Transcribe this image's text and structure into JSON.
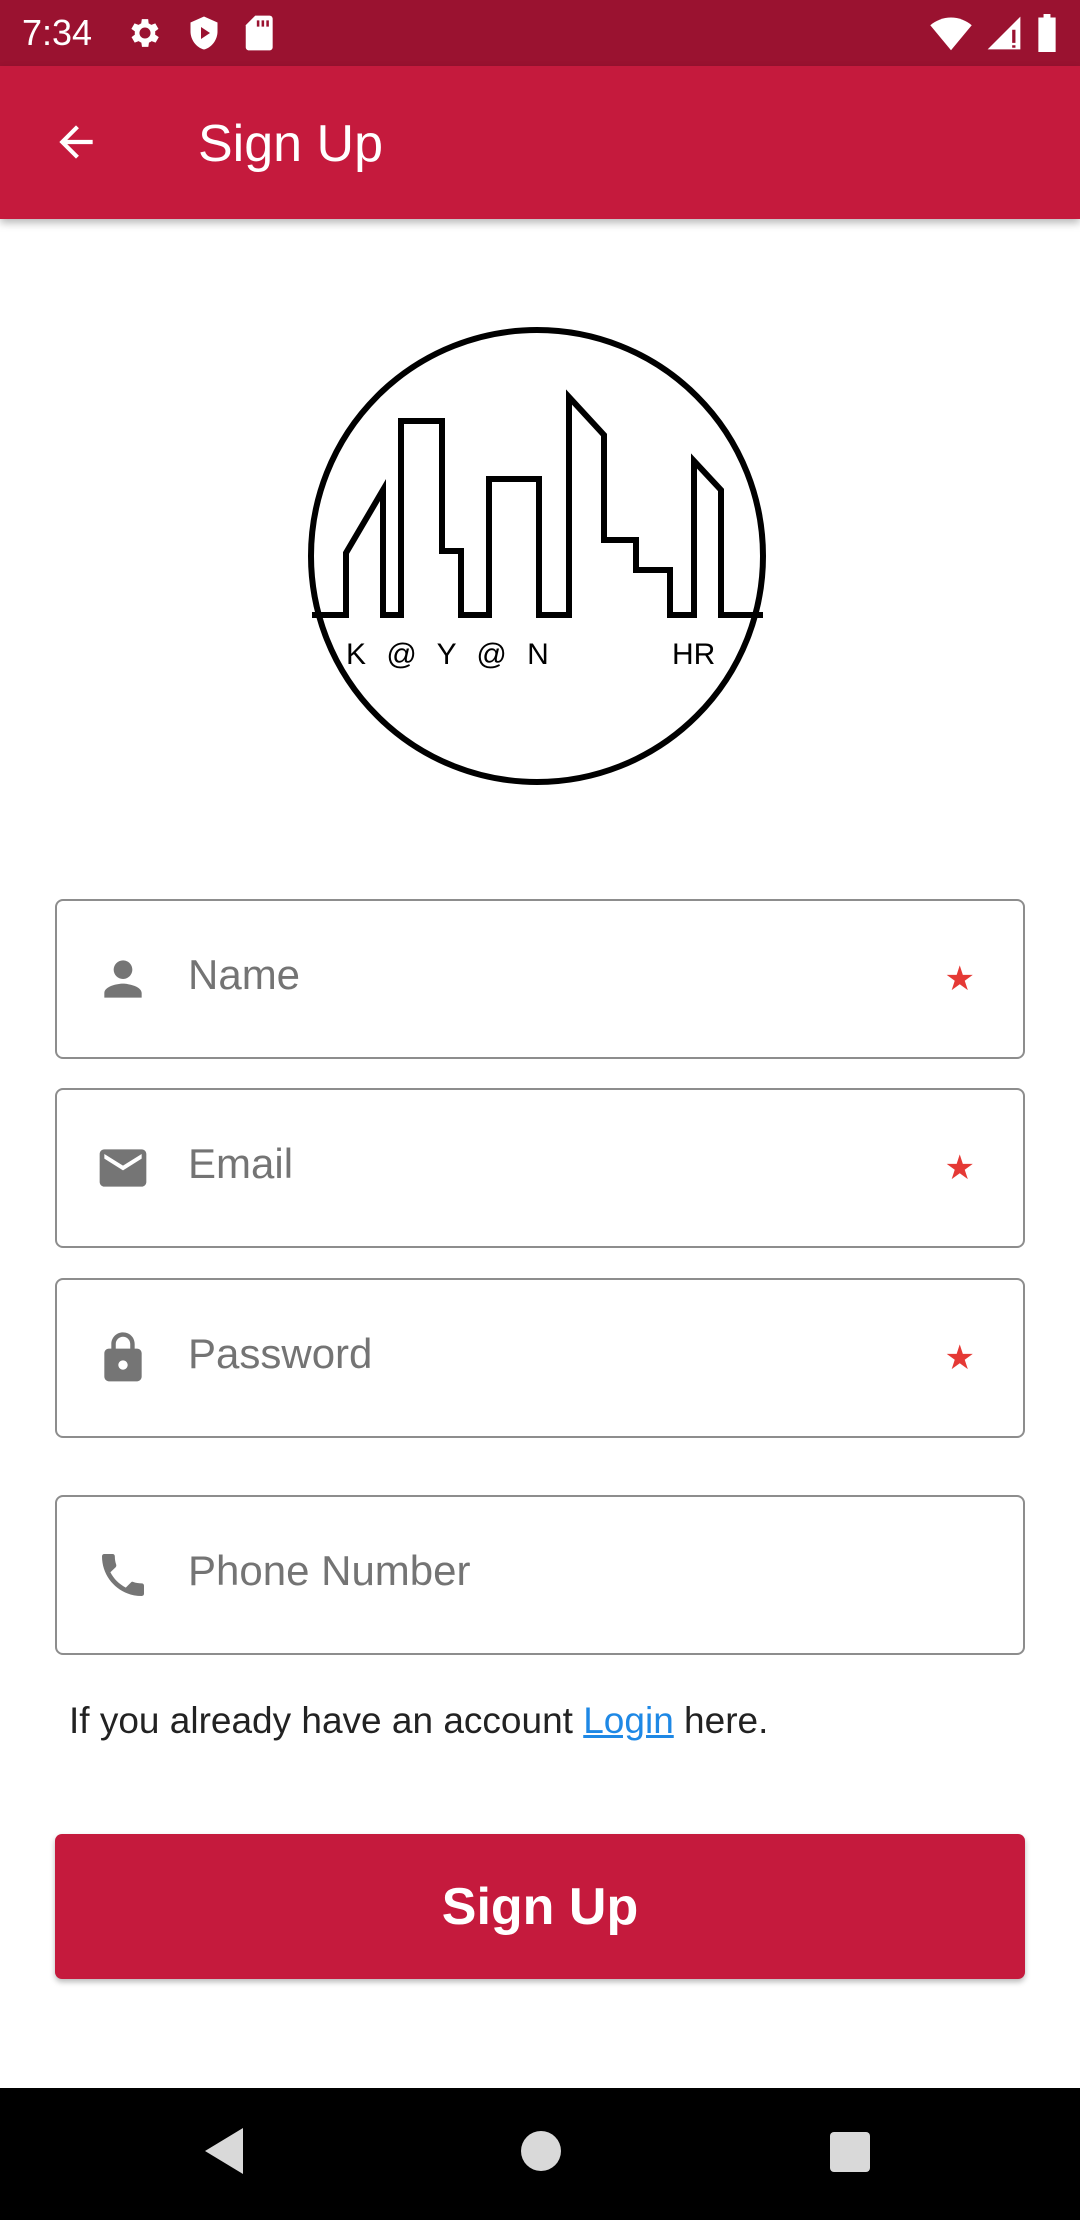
{
  "status_bar": {
    "time": "7:34",
    "left_icons": [
      "settings-icon",
      "shield-icon",
      "sd-card-icon"
    ],
    "right_icons": [
      "wifi-icon",
      "signal-icon",
      "battery-icon"
    ]
  },
  "app_bar": {
    "title": "Sign Up",
    "back_icon": "arrow-back-icon"
  },
  "logo": {
    "text_left": "K @ Y @ N",
    "text_right": "HR"
  },
  "form": {
    "fields": [
      {
        "placeholder": "Name",
        "icon": "person-icon",
        "required": true
      },
      {
        "placeholder": "Email",
        "icon": "mail-icon",
        "required": true
      },
      {
        "placeholder": "Password",
        "icon": "lock-icon",
        "required": true
      },
      {
        "placeholder": "Phone Number",
        "icon": "phone-icon",
        "required": false
      }
    ],
    "required_marker": "★"
  },
  "login_prompt": {
    "before": "If you already have an account ",
    "link": "Login",
    "after": " here."
  },
  "signup_button": {
    "label": "Sign Up"
  },
  "colors": {
    "primary": "#c51a3d",
    "status_bar": "#9a1230",
    "link": "#1e88e5",
    "required": "#e53935"
  }
}
